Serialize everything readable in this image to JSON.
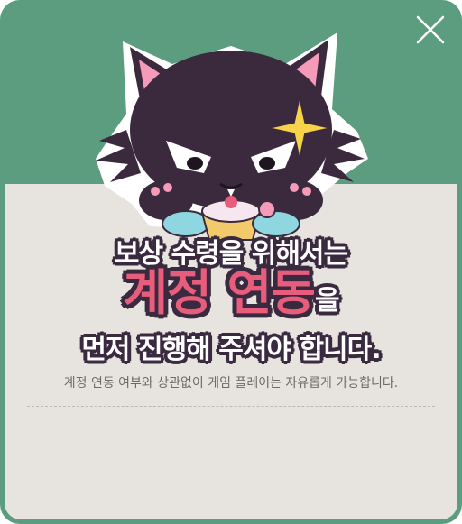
{
  "dialog": {
    "close_icon": "close-icon",
    "headline": {
      "line1": "보상 수령을 위해서는",
      "line2_emphasis": "계정 연동",
      "line2_suffix": "을",
      "line3": "먼저 진행해 주셔야 합니다."
    },
    "subtext": "계정 연동 여부와 상관없이 게임 플레이는 자유롭게 가능합니다.",
    "mascot": "black-cat-mascot"
  },
  "colors": {
    "header_bg": "#5c9c7f",
    "panel_bg": "#e7e4df",
    "emphasis": "#e85d7c",
    "outline": "#3a2a40"
  }
}
